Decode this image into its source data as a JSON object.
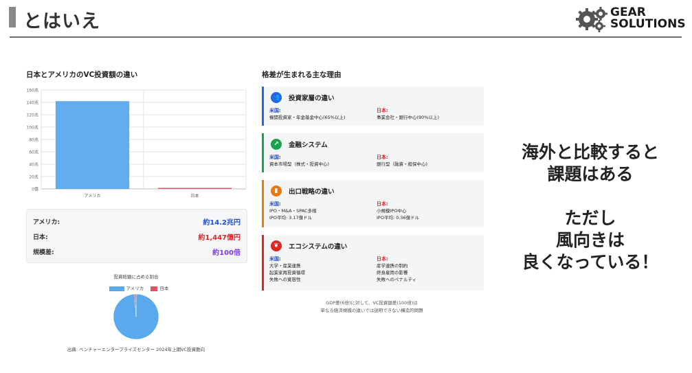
{
  "header": {
    "title": "とはいえ",
    "logo_line1": "GEAR",
    "logo_line2": "SOLUTIONS"
  },
  "left_panel": {
    "chart_title": "日本とアメリカのVC投資額の違い",
    "stats": [
      {
        "label": "アメリカ:",
        "value": "約14.2兆円",
        "color": "#1d4ed8"
      },
      {
        "label": "日本:",
        "value": "約1,447億円",
        "color": "#dc2626"
      },
      {
        "label": "規模差:",
        "value": "約100倍",
        "color": "#7c3aed"
      }
    ],
    "pie_title": "投資総額に占める割合",
    "legend": [
      "アメリカ",
      "日本"
    ],
    "source": "出典: ベンチャーエンタープライズセンター 2024年上期VC投資動向"
  },
  "chart_data": [
    {
      "type": "bar",
      "categories": [
        "アメリカ",
        "日本"
      ],
      "values": [
        142,
        1.447
      ],
      "colors": [
        "#5aa9ec",
        "#e05563"
      ],
      "ylim": [
        0,
        160
      ],
      "yticks": [
        "0億",
        "20兆",
        "40兆",
        "60兆",
        "80兆",
        "100兆",
        "120兆",
        "140兆",
        "160兆"
      ],
      "grid": true
    },
    {
      "type": "pie",
      "labels": [
        "アメリカ",
        "日本"
      ],
      "values": [
        99,
        1
      ],
      "colors": [
        "#5aa9ec",
        "#e05563"
      ],
      "legend": "top"
    }
  ],
  "right_panel": {
    "title": "格差が生まれる主な理由",
    "us_label": "米国:",
    "jp_label": "日本:",
    "reasons": [
      {
        "heading": "投資家層の違い",
        "icon": "people-icon",
        "icon_glyph": "👥",
        "accent": "#2563eb",
        "us": [
          "機関投資家・年金基金中心(65%以上)"
        ],
        "jp": [
          "事業会社・銀行中心(90%以上)"
        ]
      },
      {
        "heading": "金融システム",
        "icon": "chart-line-icon",
        "icon_glyph": "↗",
        "accent": "#16a34a",
        "us": [
          "資本市場型（株式・投資中心)"
        ],
        "jp": [
          "銀行型（融資・担保中心)"
        ]
      },
      {
        "heading": "出口戦略の違い",
        "icon": "door-icon",
        "icon_glyph": "▮",
        "accent": "#ea7a12",
        "us": [
          "IPO・M&A・SPAC多様",
          "IPO平均: 3.17億ドル"
        ],
        "jp": [
          "小規模IPO中心",
          "IPO平均: 0.36億ドル"
        ]
      },
      {
        "heading": "エコシステムの違い",
        "icon": "sprout-icon",
        "icon_glyph": "❦",
        "accent": "#dc2626",
        "us": [
          "大学・産業連携",
          "起業家再投資循環",
          "失敗への寛容性"
        ],
        "jp": [
          "産学連携の制約",
          "終身雇用の影響",
          "失敗へのペナルティ"
        ]
      }
    ],
    "note_line1": "GDP差(6倍)に対して、VC投資額差(100倍)は",
    "note_line2": "単なる経済規模の違いでは説明できない構造的問題"
  },
  "message": {
    "line1": "海外と比較すると",
    "line2": "課題はある",
    "line3": "ただし",
    "line4": "風向きは",
    "line5": "良くなっている！"
  }
}
